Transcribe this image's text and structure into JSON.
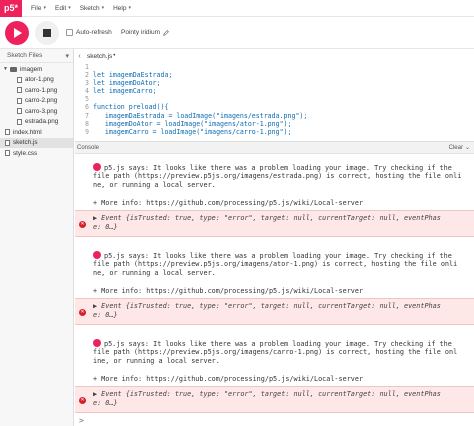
{
  "menubar": {
    "logo": "p5*",
    "items": [
      "File",
      "Edit",
      "Sketch",
      "Help"
    ]
  },
  "toolbar": {
    "autorefresh_label": "Auto-refresh",
    "project_name": "Pointy iridium"
  },
  "sidebar": {
    "title": "Sketch Files",
    "folder": "imagem",
    "files_in_folder": [
      "ator-1.png",
      "carro-1.png",
      "carro-2.png",
      "carro-3.png",
      "estrada.png"
    ],
    "root_files": [
      "index.html",
      "sketch.js",
      "style.css"
    ]
  },
  "editor": {
    "tab": "sketch.js",
    "lines": [
      {
        "n": "1",
        "text": ""
      },
      {
        "n": "2",
        "text": "let imagemDaEstrada;"
      },
      {
        "n": "3",
        "text": "let imagemDoAtor;"
      },
      {
        "n": "4",
        "text": "let imagemCarro;"
      },
      {
        "n": "5",
        "text": ""
      },
      {
        "n": "6",
        "text": "function preload(){"
      },
      {
        "n": "7",
        "text": "   imagemDaEstrada = loadImage(\"imagens/estrada.png\");"
      },
      {
        "n": "8",
        "text": "   imagemDoAtor = loadImage(\"imagens/ator-1.png\");"
      },
      {
        "n": "9",
        "text": "   imagemCarro = loadImage(\"imagens/carro-1.png\");"
      }
    ]
  },
  "console": {
    "title": "Console",
    "clear_label": "Clear",
    "messages": [
      {
        "lines": [
          "p5.js says: It looks like there was a problem loading your image. Try checking if the",
          "file path (https://preview.p5js.org/imagens/estrada.png) is correct, hosting the file onli",
          "ne, or running a local server.",
          "",
          "+ More info: https://github.com/processing/p5.js/wiki/Local-server"
        ],
        "event_line1": "▶ Event {isTrusted: true, type: \"error\", target: null, currentTarget: null, eventPhas",
        "event_line2": "e: 0…}"
      },
      {
        "lines": [
          "p5.js says: It looks like there was a problem loading your image. Try checking if the",
          "file path (https://preview.p5js.org/imagens/ator-1.png) is correct, hosting the file onli",
          "ne, or running a local server.",
          "",
          "+ More info: https://github.com/processing/p5.js/wiki/Local-server"
        ],
        "event_line1": "▶ Event {isTrusted: true, type: \"error\", target: null, currentTarget: null, eventPhas",
        "event_line2": "e: 0…}"
      },
      {
        "lines": [
          "p5.js says: It looks like there was a problem loading your image. Try checking if the",
          "file path (https://preview.p5js.org/imagens/carro-1.png) is correct, hosting the file onl",
          "ine, or running a local server.",
          "",
          "+ More info: https://github.com/processing/p5.js/wiki/Local-server"
        ],
        "event_line1": "▶ Event {isTrusted: true, type: \"error\", target: null, currentTarget: null, eventPhas",
        "event_line2": "e: 0…}"
      }
    ],
    "prompt": ">"
  },
  "colors": {
    "accent": "#ed225d",
    "error_bg": "#fde7e7",
    "code_blue": "#0b6bb3"
  }
}
